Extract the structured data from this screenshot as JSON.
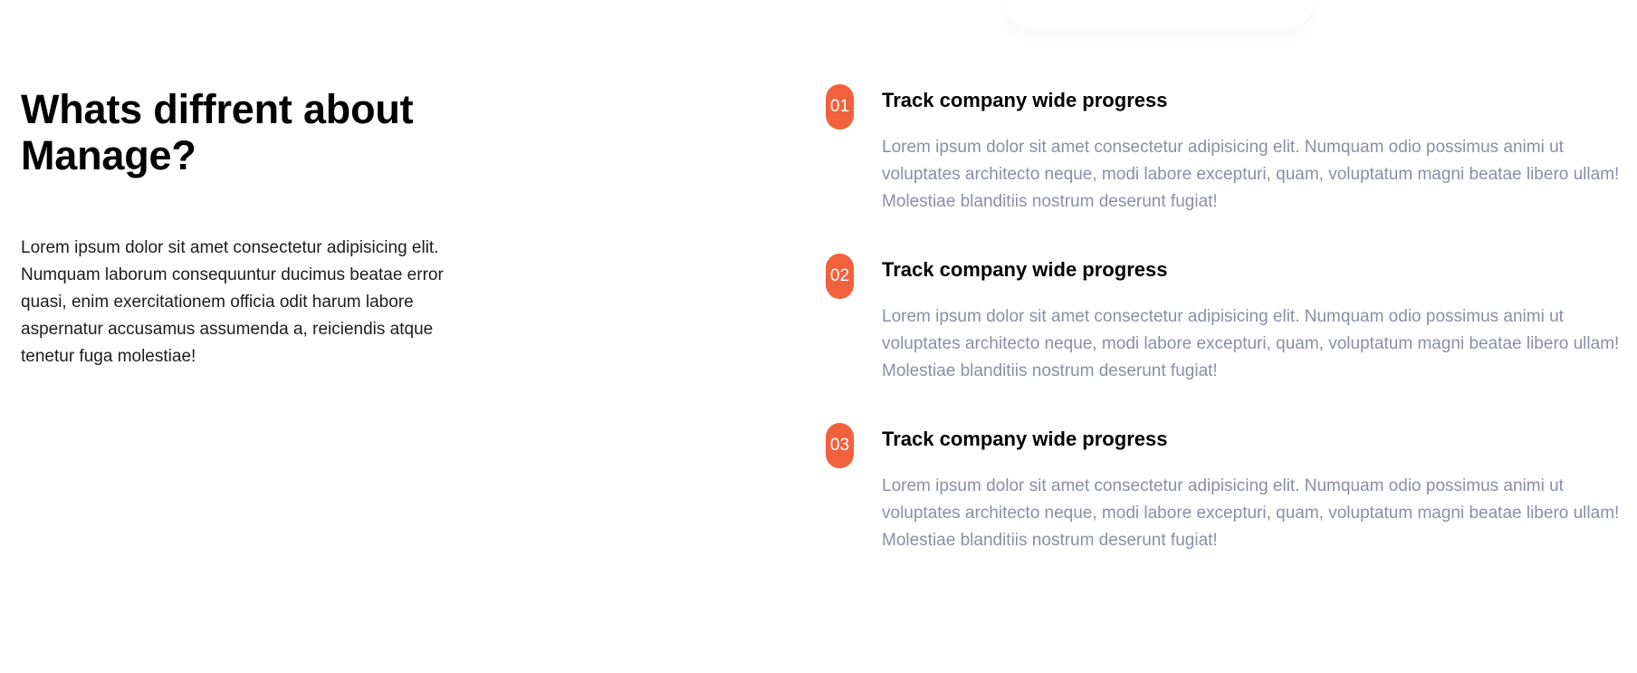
{
  "colors": {
    "accent": "#f1613c",
    "heading": "#000000",
    "muted_text": "#8a8fa3",
    "body_text": "#1d1d1d"
  },
  "section": {
    "title": "Whats diffrent about Manage?",
    "intro": "Lorem ipsum dolor sit amet consectetur adipisicing elit. Numquam laborum consequuntur ducimus beatae error quasi, enim exercitationem officia odit harum labore aspernatur accusamus assumenda a, reiciendis atque tenetur fuga molestiae!"
  },
  "features": [
    {
      "number": "01",
      "title": "Track company wide progress",
      "description": "Lorem ipsum dolor sit amet consectetur adipisicing elit. Numquam odio possimus animi ut voluptates architecto neque, modi labore excepturi, quam, voluptatum magni beatae libero ullam! Molestiae blanditiis nostrum deserunt fugiat!"
    },
    {
      "number": "02",
      "title": "Track company wide progress",
      "description": "Lorem ipsum dolor sit amet consectetur adipisicing elit. Numquam odio possimus animi ut voluptates architecto neque, modi labore excepturi, quam, voluptatum magni beatae libero ullam! Molestiae blanditiis nostrum deserunt fugiat!"
    },
    {
      "number": "03",
      "title": "Track company wide progress",
      "description": "Lorem ipsum dolor sit amet consectetur adipisicing elit. Numquam odio possimus animi ut voluptates architecto neque, modi labore excepturi, quam, voluptatum magni beatae libero ullam! Molestiae blanditiis nostrum deserunt fugiat!"
    }
  ]
}
